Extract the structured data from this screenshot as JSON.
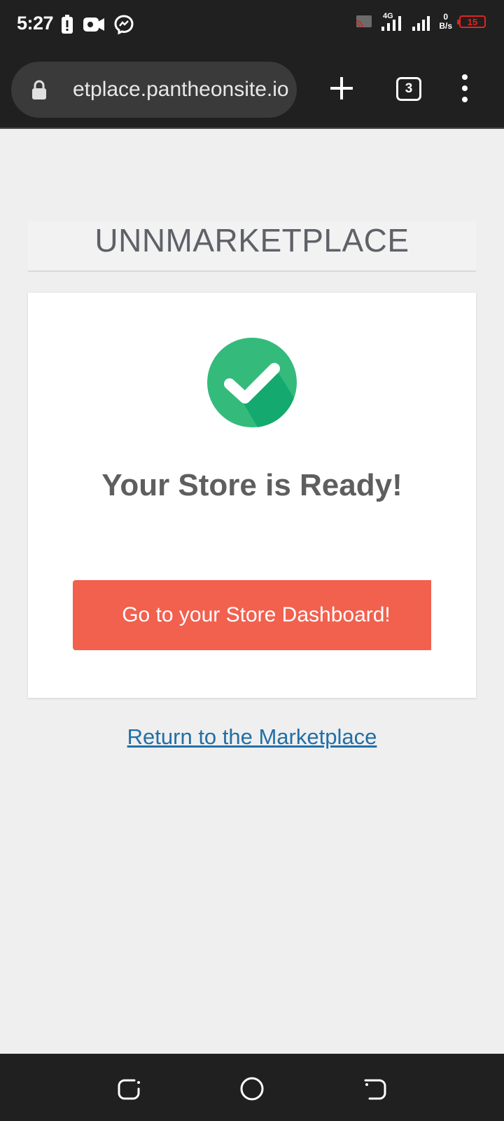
{
  "status_bar": {
    "time": "5:27",
    "network": "4G",
    "speed_value": "0",
    "speed_unit": "B/s",
    "battery": "15"
  },
  "browser": {
    "url": "etplace.pantheonsite.io",
    "tab_count": "3"
  },
  "page": {
    "site_title": "UNNMARKETPLACE",
    "heading": "Your Store is Ready!",
    "dashboard_button": "Go to your Store Dashboard!",
    "return_link": "Return to the Marketplace"
  },
  "colors": {
    "button": "#f2604e",
    "check": "#34bb7c",
    "link": "#226fa6"
  }
}
